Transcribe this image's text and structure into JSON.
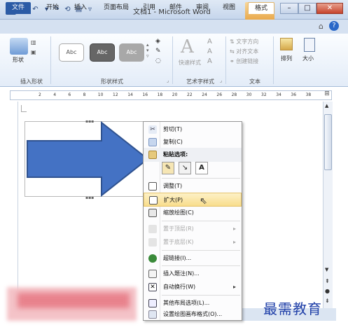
{
  "titlebar": {
    "title": "文档1 - Microsoft Word",
    "context_tab_header": "绘图...",
    "quick_access": [
      "save-icon",
      "undo-icon",
      "redo-icon",
      "repeat-icon",
      "open-icon",
      "dropdown-icon"
    ]
  },
  "window_controls": {
    "minimize": "–",
    "maximize": "□",
    "close": "✕"
  },
  "tabs": [
    "文件",
    "开始",
    "插入",
    "页面布局",
    "引用",
    "邮件",
    "审阅",
    "视图",
    "格式"
  ],
  "ribbon": {
    "insert_shapes": {
      "button": "形状",
      "label": "插入形状"
    },
    "shape_styles": {
      "swatches": [
        "Abc",
        "Abc",
        "Abc"
      ],
      "label": "形状样式"
    },
    "wordart": {
      "button": "快速样式",
      "label": "艺术字样式"
    },
    "text": {
      "items": [
        "文字方向",
        "对齐文本",
        "创建链接"
      ],
      "label": "文本"
    },
    "arrange": {
      "button": "排列"
    },
    "size": {
      "button": "大小"
    }
  },
  "ruler_ticks": [
    "2",
    "4",
    "6",
    "8",
    "10",
    "12",
    "14",
    "16",
    "18",
    "20",
    "22",
    "24",
    "26",
    "28",
    "30",
    "32",
    "34",
    "36",
    "38"
  ],
  "context_menu": {
    "cut": "剪切(T)",
    "copy": "复制(C)",
    "paste_options": "粘贴选项:",
    "paste_text_option": "A",
    "adjust": "调整(T)",
    "expand": "扩大(P)",
    "shrink": "缩放绘图(C)",
    "bring_front": "置于顶层(R)",
    "send_back": "置于底层(K)",
    "hyperlink": "超链接(I)...",
    "insert_caption": "插入题注(N)...",
    "text_wrap": "自动换行(W)",
    "layout_options": "其他布局选项(L)...",
    "canvas_format": "设置绘图画布格式(O)..."
  },
  "watermark": "最需教育",
  "colors": {
    "arrow_fill": "#4472c4",
    "arrow_stroke": "#2f528f",
    "highlight": "#f8dd8c"
  }
}
